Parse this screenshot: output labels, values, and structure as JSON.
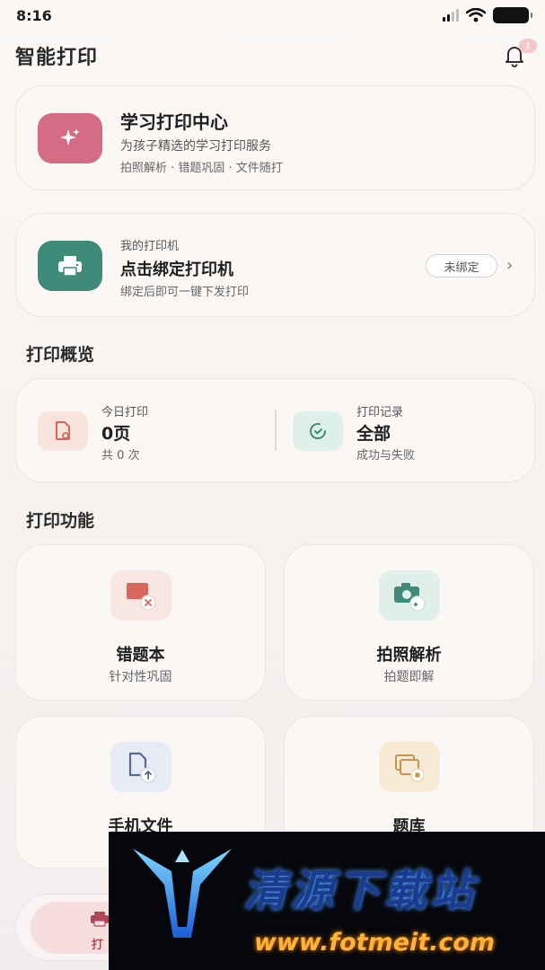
{
  "status_bar": {
    "time": "8:16"
  },
  "header": {
    "title": "智能打印",
    "notification_badge": "1"
  },
  "hero": {
    "title": "学习打印中心",
    "subtitle": "为孩子精选的学习打印服务",
    "tags": "拍照解析 · 错题巩固 · 文件随打",
    "icon": "sparkle-icon",
    "color": "#d46c83"
  },
  "printer": {
    "label": "我的打印机",
    "title": "点击绑定打印机",
    "desc": "绑定后即可一键下发打印",
    "status_badge": "未绑定",
    "chevron": "›",
    "icon": "printer-icon",
    "color": "#3f8a78"
  },
  "overview": {
    "section_title": "打印概览",
    "today": {
      "label": "今日打印",
      "value": "0页",
      "sub": "共 0 次",
      "icon": "document-icon"
    },
    "records": {
      "label": "打印记录",
      "value": "全部",
      "sub": "成功与失败",
      "icon": "clock-icon"
    }
  },
  "functions": {
    "section_title": "打印功能",
    "items": [
      {
        "title": "错题本",
        "sub": "针对性巩固",
        "icon": "wrong-book-icon",
        "color": "#d7675a"
      },
      {
        "title": "拍照解析",
        "sub": "拍题即解",
        "icon": "camera-icon",
        "color": "#3f8a78"
      },
      {
        "title": "手机文件",
        "sub": "",
        "icon": "file-upload-icon",
        "color": "#5a6a8a"
      },
      {
        "title": "题库",
        "sub": "",
        "icon": "question-bank-icon",
        "color": "#c7944a"
      }
    ]
  },
  "tabbar": {
    "active_label": "打"
  },
  "watermark": {
    "title": "清源下载站",
    "url": "www.fotmeit.com"
  }
}
